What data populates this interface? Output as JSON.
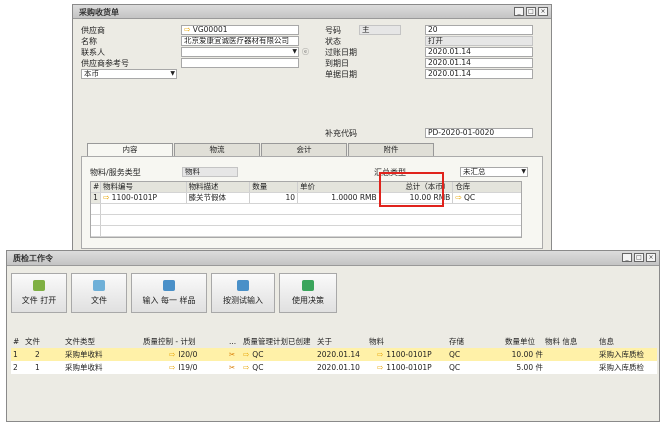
{
  "purchase": {
    "title": "采购收货单",
    "left": [
      {
        "label": "供应商",
        "value": "VG00001",
        "arrow": true
      },
      {
        "label": "名称",
        "value": "北京爱康宜诚医疗器材有限公司"
      },
      {
        "label": "联系人",
        "value": "",
        "dropdown": true
      },
      {
        "label": "供应商参考号",
        "value": ""
      },
      {
        "label": "本币",
        "value": "",
        "dropdown": true
      }
    ],
    "right": [
      {
        "label": "号码",
        "sub": "主",
        "value": "20"
      },
      {
        "label": "状态",
        "value": "打开"
      },
      {
        "label": "过账日期",
        "value": "2020.01.14"
      },
      {
        "label": "到期日",
        "value": "2020.01.14"
      },
      {
        "label": "单据日期",
        "value": "2020.01.14"
      }
    ],
    "supp_code_label": "补充代码",
    "supp_code_value": "PD-2020-01-0020",
    "tabs": [
      "内容",
      "物流",
      "会计",
      "附件"
    ],
    "item_type_label": "物料/服务类型",
    "item_type_value": "物料",
    "summary_label": "汇总类型",
    "summary_value": "未汇总",
    "grid_headers": [
      "#",
      "物料编号",
      "物料描述",
      "数量",
      "单价",
      "总计（本币）",
      "仓库"
    ],
    "grid_rows": [
      {
        "num": "1",
        "item": "1100-0101P",
        "desc": "膝关节假体",
        "qty": "10",
        "price": "1.0000 RMB",
        "total": "10.00 RMB",
        "wh": "QC"
      }
    ]
  },
  "qc": {
    "title": "质检工作令",
    "toolbar": [
      "文件 打开",
      "文件",
      "输入 每一 样品",
      "按测试输入",
      "使用决策"
    ],
    "headers": [
      "#",
      "文件",
      "文件类型",
      "质量控制 - 计划",
      "...",
      "质量管理计划已创建",
      "关于",
      "物料",
      "存储",
      "数量单位",
      "物料 信息",
      "信息"
    ],
    "rows": [
      {
        "num": "1",
        "doc": "2",
        "type": "采购单收料",
        "plan": "I20/0",
        "qm": "QC",
        "date": "2020.01.14",
        "item": "1100-0101P",
        "store": "QC",
        "qty": "10.00 件",
        "info": "采购入库质检"
      },
      {
        "num": "2",
        "doc": "1",
        "type": "采购单收料",
        "plan": "I19/0",
        "qm": "QC",
        "date": "2020.01.10",
        "item": "1100-0101P",
        "store": "QC",
        "qty": "5.00 件",
        "info": "采购入库质检"
      }
    ]
  },
  "icons": {
    "link": "arrow-link-icon",
    "minimize": "minimize-icon",
    "maximize": "maximize-icon",
    "close": "close-icon"
  }
}
